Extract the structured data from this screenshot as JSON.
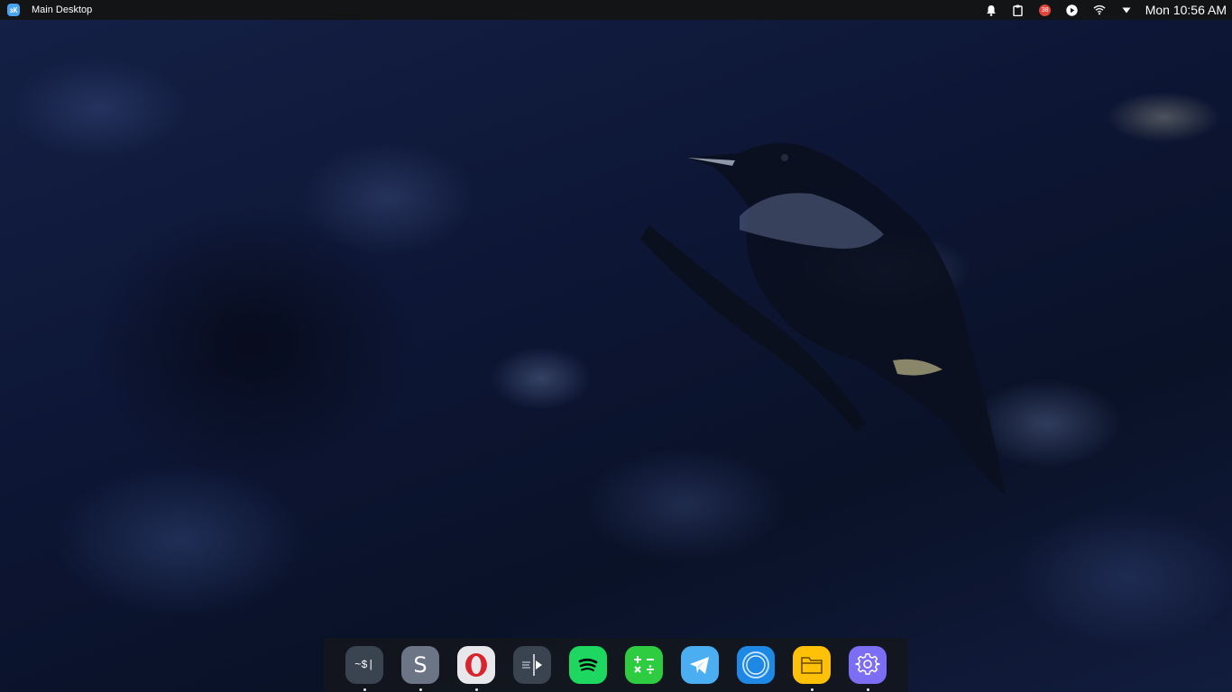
{
  "topbar": {
    "logo_text": "зК",
    "title": "Main Desktop",
    "notification_badge": "38",
    "clock": "Mon 10:56 AM"
  },
  "tray_icons": [
    "bell-icon",
    "clipboard-icon",
    "notification-badge",
    "play-icon",
    "wifi-icon",
    "dropdown-arrow-icon"
  ],
  "dock": {
    "apps": [
      {
        "name": "terminal",
        "label": "~$|",
        "color": "#3a4451",
        "running": true
      },
      {
        "name": "sublime-text",
        "label": "S",
        "color": "#6b7585",
        "running": true
      },
      {
        "name": "opera-browser",
        "label": "O",
        "color": "#e8e8ec",
        "running": true
      },
      {
        "name": "media-player",
        "label": "▶",
        "color": "#3a4451",
        "running": false
      },
      {
        "name": "spotify",
        "label": "",
        "color": "#1ed760",
        "running": false
      },
      {
        "name": "calculator",
        "label": "+ − × ÷",
        "color": "#2ecc40",
        "running": false
      },
      {
        "name": "telegram",
        "label": "",
        "color": "#4aaef0",
        "running": false
      },
      {
        "name": "browser-circle",
        "label": "",
        "color": "#1e88e5",
        "running": false
      },
      {
        "name": "files",
        "label": "",
        "color": "#ffc107",
        "running": true
      },
      {
        "name": "settings",
        "label": "",
        "color": "#7c6df5",
        "running": true
      }
    ]
  }
}
